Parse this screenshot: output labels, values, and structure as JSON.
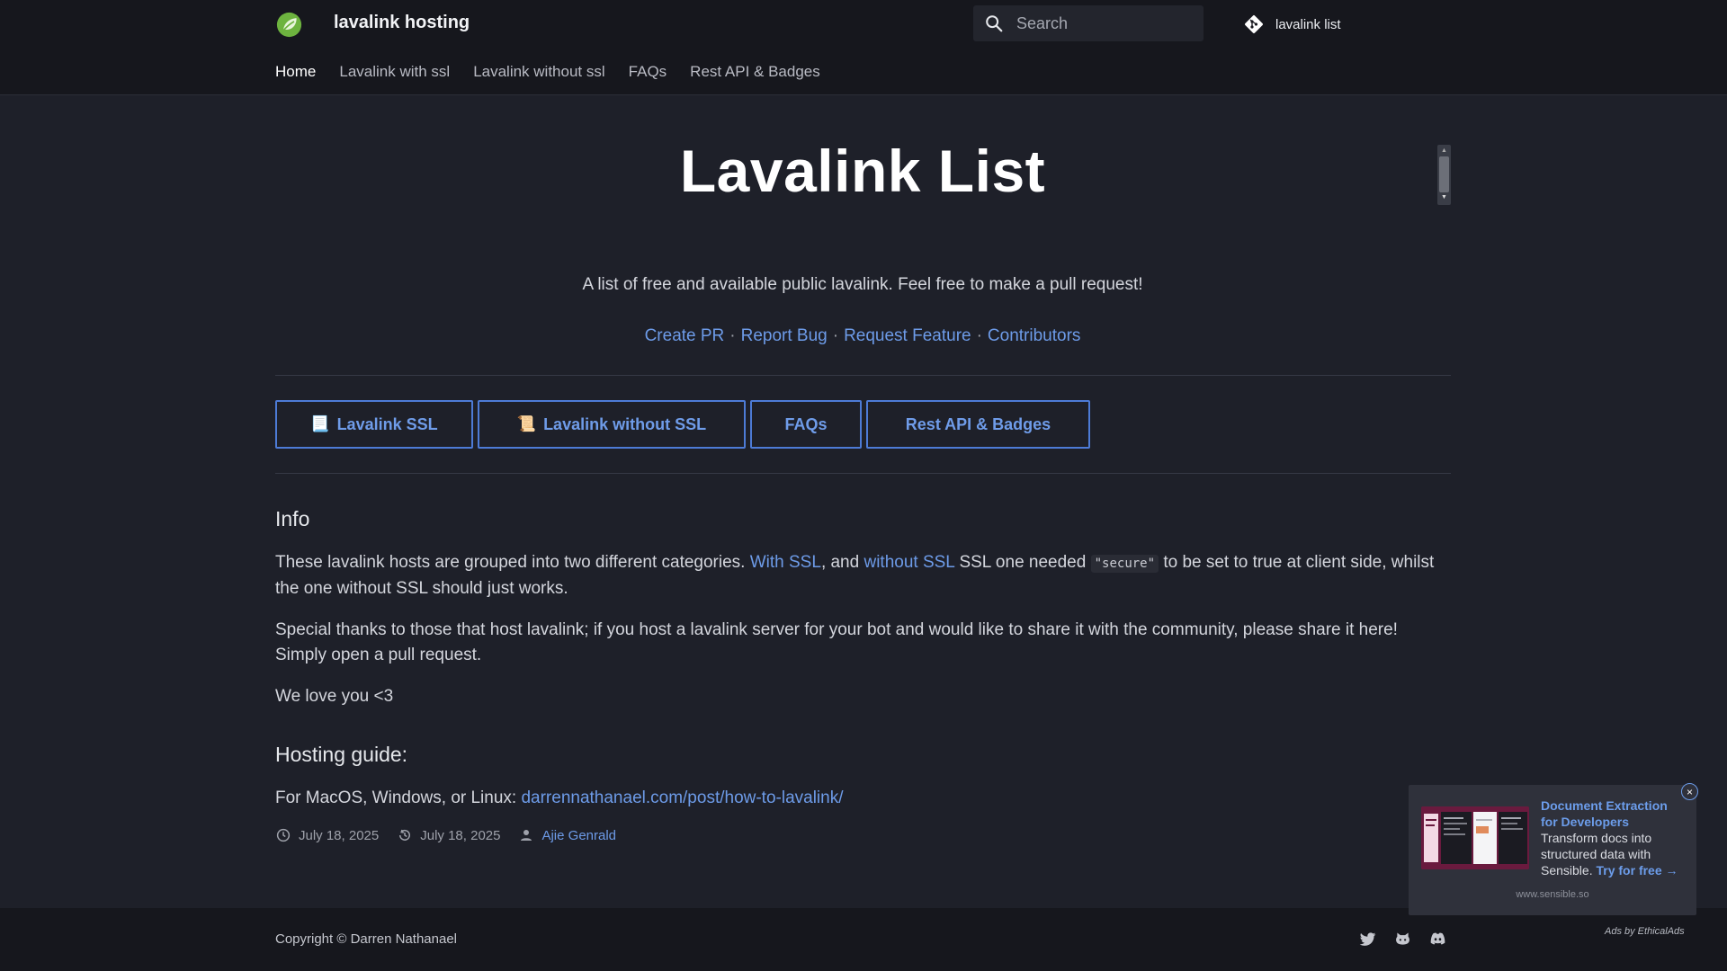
{
  "header": {
    "site_title": "lavalink hosting",
    "search_placeholder": "Search",
    "repo_label": "lavalink list",
    "nav": [
      "Home",
      "Lavalink with ssl",
      "Lavalink without ssl",
      "FAQs",
      "Rest API & Badges"
    ],
    "active_nav": "Home"
  },
  "main": {
    "title": "Lavalink List",
    "tagline": "A list of free and available public lavalink. Feel free to make a pull request!",
    "links": [
      "Create PR",
      "Report Bug",
      "Request Feature",
      "Contributors"
    ],
    "separator": "·",
    "buttons": [
      {
        "emoji": "📃",
        "label": "Lavalink SSL"
      },
      {
        "emoji": "📜",
        "label": "Lavalink without SSL"
      },
      {
        "emoji": "",
        "label": "FAQs"
      },
      {
        "emoji": "",
        "label": "Rest API & Badges"
      }
    ],
    "info_heading": "Info",
    "info_p1_a": "These lavalink hosts are grouped into two different categories. ",
    "info_p1_link1": "With SSL",
    "info_p1_b": ", and ",
    "info_p1_link2": "without SSL",
    "info_p1_c": " SSL one needed ",
    "info_p1_code": "\"secure\"",
    "info_p1_d": " to be set to true at client side, whilst the one without SSL should just works.",
    "info_p2": "Special thanks to those that host lavalink; if you host a lavalink server for your bot and would like to share it with the community, please share it here! Simply open a pull request.",
    "info_p3": "We love you <3",
    "guide_heading": "Hosting guide:",
    "guide_prefix": "For MacOS, Windows, or Linux: ",
    "guide_link": "darrennathanael.com/post/how-to-lavalink/",
    "meta": {
      "created": "July 18, 2025",
      "updated": "July 18, 2025",
      "author": "Ajie Genrald"
    }
  },
  "footer": {
    "copyright": "Copyright © Darren Nathanael",
    "social_icons": [
      "twitter-icon",
      "github-icon",
      "discord-icon"
    ]
  },
  "ad": {
    "title": "Document Extraction for Developers",
    "text": " Transform docs into structured data with Sensible. ",
    "cta": "Try for free →",
    "domain": "www.sensible.so",
    "by": "Ads by EthicalAds",
    "close": "×"
  },
  "colors": {
    "background": "#1e2029",
    "header": "#16171d",
    "accent": "#6d9be8",
    "logo": "#6db33f"
  }
}
